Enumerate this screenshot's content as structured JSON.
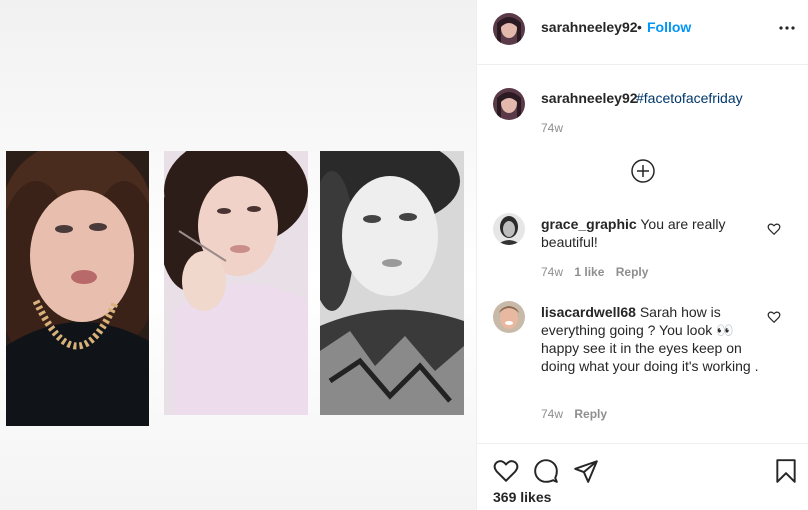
{
  "post": {
    "author": "sarahneeley92",
    "follow_label": "Follow",
    "separator": "•",
    "caption_hashtag": "#facetofacefriday",
    "caption_time": "74w",
    "likes_label": "369 likes"
  },
  "comments": [
    {
      "username": "grace_graphic",
      "text": "You are really beautiful!",
      "time": "74w",
      "likes": "1 like",
      "reply_label": "Reply"
    },
    {
      "username": "lisacardwell68",
      "text": "Sarah how is everything going ? You look 👀 happy see it in the eyes keep on doing what your doing it's working .",
      "time": "74w",
      "reply_label": "Reply"
    }
  ],
  "icons": {
    "more": "more-options-icon",
    "load_more": "plus-circle-icon",
    "like": "heart-icon",
    "comment": "comment-icon",
    "share": "share-icon",
    "save": "bookmark-icon"
  },
  "colors": {
    "link_blue": "#0095f6",
    "hashtag": "#00376b",
    "muted": "#8e8e8e",
    "text": "#262626"
  }
}
